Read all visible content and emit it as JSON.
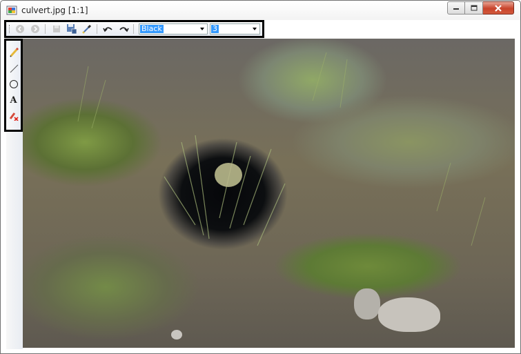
{
  "window": {
    "title": "culvert.jpg [1:1]",
    "controls": [
      "minimize",
      "maximize",
      "close"
    ]
  },
  "toolbar": {
    "buttons": [
      {
        "name": "back-icon",
        "enabled": false
      },
      {
        "name": "forward-icon",
        "enabled": false
      },
      {
        "name": "save-icon",
        "enabled": false
      },
      {
        "name": "save-as-icon",
        "enabled": true
      },
      {
        "name": "eyedropper-icon",
        "enabled": true
      },
      {
        "name": "undo-icon",
        "enabled": true
      },
      {
        "name": "redo-icon",
        "enabled": true
      }
    ],
    "color_select": "Black",
    "size_select": "3"
  },
  "sidebar": {
    "tools": [
      {
        "name": "pencil-icon"
      },
      {
        "name": "line-icon"
      },
      {
        "name": "ellipse-icon"
      },
      {
        "name": "text-icon",
        "glyph": "A"
      },
      {
        "name": "clear-drawing-icon"
      }
    ]
  },
  "colors": {
    "accent_selection": "#3399ff",
    "close_button": "#c8432b",
    "highlight_border": "#000000"
  },
  "canvas": {
    "image_description_icon": "photo-canvas"
  }
}
